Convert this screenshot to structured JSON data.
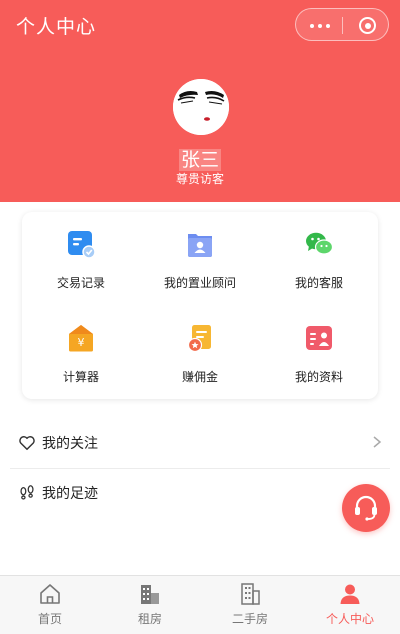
{
  "header": {
    "title": "个人中心",
    "background_color": "#f75c59"
  },
  "capsule": {
    "more_icon": "more-dots-icon",
    "close_icon": "target-close-icon"
  },
  "profile": {
    "avatar_icon": "face-avatar",
    "name": "张三",
    "tag": "尊贵访客"
  },
  "grid": [
    {
      "label": "交易记录",
      "icon": "transaction-record-icon"
    },
    {
      "label": "我的置业顾问",
      "icon": "consultant-icon"
    },
    {
      "label": "我的客服",
      "icon": "wechat-service-icon"
    },
    {
      "label": "计算器",
      "icon": "calculator-icon"
    },
    {
      "label": "赚佣金",
      "icon": "commission-icon"
    },
    {
      "label": "我的资料",
      "icon": "profile-card-icon"
    }
  ],
  "list": [
    {
      "label": "我的关注",
      "icon": "heart-icon"
    },
    {
      "label": "我的足迹",
      "icon": "footprint-icon"
    }
  ],
  "fab": {
    "icon": "headset-icon",
    "color": "#f75c59"
  },
  "tabbar": {
    "active_color": "#f75c59",
    "tabs": [
      {
        "label": "首页",
        "icon": "home-icon",
        "active": false
      },
      {
        "label": "租房",
        "icon": "rent-building-icon",
        "active": false
      },
      {
        "label": "二手房",
        "icon": "secondhand-building-icon",
        "active": false
      },
      {
        "label": "个人中心",
        "icon": "person-icon",
        "active": true
      }
    ]
  }
}
